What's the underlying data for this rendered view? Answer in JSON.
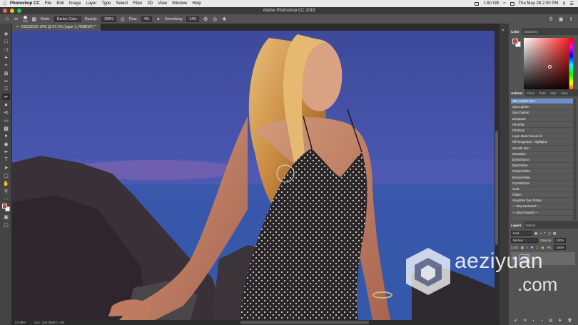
{
  "menubar": {
    "app_name": "Photoshop CC",
    "menus": [
      "File",
      "Edit",
      "Image",
      "Layer",
      "Type",
      "Select",
      "Filter",
      "3D",
      "View",
      "Window",
      "Help"
    ],
    "storage": "1.60 GB",
    "datetime": "Thu May 28  2:00 PM"
  },
  "window": {
    "title": "Adobe Photoshop CC 2019"
  },
  "options": {
    "brush_size": "200",
    "mode_label": "Mode:",
    "mode_value": "Darker Color",
    "opacity_label": "Opacity:",
    "opacity_value": "100%",
    "flow_label": "Flow:",
    "flow_value": "4%",
    "smoothing_label": "Smoothing:",
    "smoothing_value": "14%"
  },
  "document": {
    "tab_title": "DSC02187.JPG @ 57.1% (Layer 1, RGB/16*) *"
  },
  "status": {
    "zoom": "57.09%",
    "doc_info": "Doc: 235.6M/471.1M"
  },
  "color_panel": {
    "tabs": [
      "Color",
      "Swatches"
    ],
    "foreground": "#c24545",
    "background": "#ffffff"
  },
  "actions_panel": {
    "tabs": [
      "Actions",
      "Chan",
      "Path",
      "Adju",
      "Libra"
    ],
    "items": [
      "SBL Actions 20.4",
      "Spot Lighten",
      "Spot Darken",
      "DeepDark",
      "Fill White",
      "Fill Black",
      "Layer Mask Reveal All",
      "Fill foreground - Highlights",
      "Smooth Skin",
      "Neutralize",
      "EyeEnhance",
      "Blue/Yellow",
      "Purple/Yellow",
      "Brown/Yellow",
      "Crystal/Clear",
      "Grain",
      "Flatten",
      "SnapShot then Flatten",
      "— Step Backward —",
      "— Step Forward —"
    ],
    "selected_index": 0
  },
  "layers_panel": {
    "tabs": [
      "Layers",
      "History"
    ],
    "filter_label": "Kind",
    "blend_mode": "Normal",
    "opacity_label": "Opacity:",
    "opacity_value": "100%",
    "lock_label": "Lock:",
    "fill_label": "Fill:",
    "fill_value": "100%"
  },
  "watermark": {
    "line1": "aeziyuan",
    "line2": ".com"
  }
}
